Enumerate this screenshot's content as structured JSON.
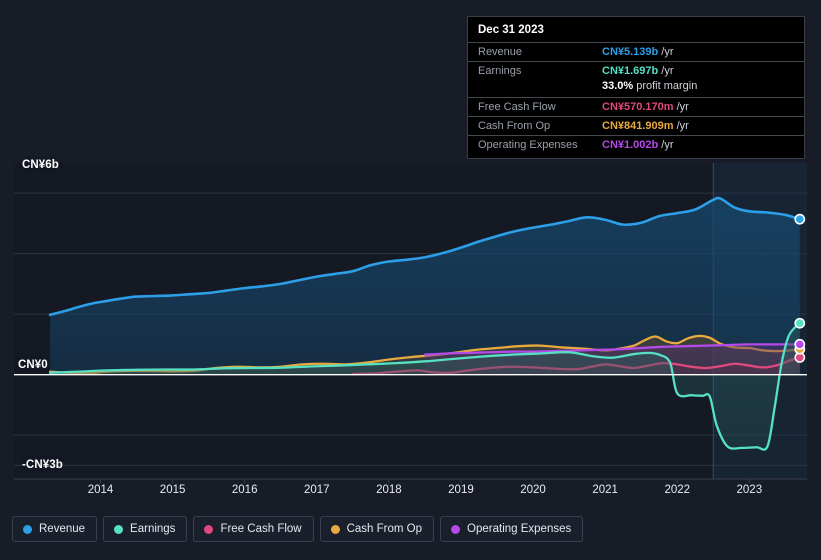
{
  "chart_data": {
    "type": "area",
    "title": "",
    "xlabel": "",
    "ylabel": "",
    "currency": "CN¥",
    "xlim": [
      2013.3,
      2024.3
    ],
    "ylim": [
      -3.45,
      6.6
    ],
    "grid": true,
    "legend_position": "bottom",
    "y_ticks": [
      {
        "value": 6,
        "label": "CN¥6b"
      },
      {
        "value": 0,
        "label": "CN¥0"
      },
      {
        "value": -3,
        "label": "-CN¥3b"
      }
    ],
    "y_gridlines": [
      6,
      4,
      2,
      0,
      -2,
      -3
    ],
    "x_ticks": [
      "2014",
      "2015",
      "2016",
      "2017",
      "2018",
      "2019",
      "2020",
      "2021",
      "2022",
      "2023"
    ],
    "forecast_divider_year": 2023.0,
    "series": [
      {
        "name": "Revenue",
        "color": "#2d9fe8",
        "fill": "#17496e",
        "start_year": 2013.8,
        "points": [
          [
            2013.8,
            1.98
          ],
          [
            2014.0,
            2.1
          ],
          [
            2014.2,
            2.24
          ],
          [
            2014.4,
            2.36
          ],
          [
            2014.6,
            2.44
          ],
          [
            2014.8,
            2.52
          ],
          [
            2015.0,
            2.58
          ],
          [
            2015.25,
            2.6
          ],
          [
            2015.5,
            2.62
          ],
          [
            2015.75,
            2.66
          ],
          [
            2016.0,
            2.7
          ],
          [
            2016.25,
            2.78
          ],
          [
            2016.5,
            2.86
          ],
          [
            2016.75,
            2.92
          ],
          [
            2017.0,
            3.0
          ],
          [
            2017.25,
            3.12
          ],
          [
            2017.5,
            3.24
          ],
          [
            2017.75,
            3.33
          ],
          [
            2018.0,
            3.42
          ],
          [
            2018.25,
            3.62
          ],
          [
            2018.5,
            3.74
          ],
          [
            2018.75,
            3.8
          ],
          [
            2019.0,
            3.88
          ],
          [
            2019.25,
            4.02
          ],
          [
            2019.5,
            4.2
          ],
          [
            2019.75,
            4.4
          ],
          [
            2020.0,
            4.58
          ],
          [
            2020.25,
            4.74
          ],
          [
            2020.5,
            4.86
          ],
          [
            2020.75,
            4.96
          ],
          [
            2021.0,
            5.08
          ],
          [
            2021.25,
            5.2
          ],
          [
            2021.5,
            5.12
          ],
          [
            2021.75,
            4.96
          ],
          [
            2022.0,
            5.02
          ],
          [
            2022.25,
            5.24
          ],
          [
            2022.5,
            5.34
          ],
          [
            2022.75,
            5.46
          ],
          [
            2023.0,
            5.78
          ],
          [
            2023.1,
            5.82
          ],
          [
            2023.3,
            5.52
          ],
          [
            2023.5,
            5.4
          ],
          [
            2023.75,
            5.36
          ],
          [
            2024.0,
            5.28
          ],
          [
            2024.2,
            5.14
          ]
        ],
        "end_value": 5.139,
        "end_label": "CN¥5.139b"
      },
      {
        "name": "Earnings",
        "color": "#56e0c4",
        "fill": "#2a5f60",
        "start_year": 2013.8,
        "points": [
          [
            2013.8,
            0.06
          ],
          [
            2014.2,
            0.1
          ],
          [
            2014.6,
            0.14
          ],
          [
            2015.0,
            0.16
          ],
          [
            2015.4,
            0.17
          ],
          [
            2015.8,
            0.17
          ],
          [
            2016.2,
            0.21
          ],
          [
            2016.6,
            0.22
          ],
          [
            2017.0,
            0.23
          ],
          [
            2017.4,
            0.27
          ],
          [
            2017.8,
            0.3
          ],
          [
            2018.2,
            0.34
          ],
          [
            2018.6,
            0.38
          ],
          [
            2019.0,
            0.44
          ],
          [
            2019.4,
            0.52
          ],
          [
            2019.8,
            0.6
          ],
          [
            2020.2,
            0.66
          ],
          [
            2020.6,
            0.7
          ],
          [
            2021.0,
            0.74
          ],
          [
            2021.3,
            0.62
          ],
          [
            2021.6,
            0.56
          ],
          [
            2021.9,
            0.68
          ],
          [
            2022.1,
            0.72
          ],
          [
            2022.25,
            0.66
          ],
          [
            2022.4,
            0.4
          ],
          [
            2022.5,
            -0.62
          ],
          [
            2022.7,
            -0.68
          ],
          [
            2022.85,
            -0.7
          ],
          [
            2022.95,
            -0.72
          ],
          [
            2023.05,
            -1.7
          ],
          [
            2023.2,
            -2.38
          ],
          [
            2023.4,
            -2.42
          ],
          [
            2023.6,
            -2.4
          ],
          [
            2023.75,
            -2.38
          ],
          [
            2023.85,
            -1.1
          ],
          [
            2023.95,
            0.4
          ],
          [
            2024.05,
            1.3
          ],
          [
            2024.2,
            1.7
          ]
        ],
        "end_value": 1.697,
        "end_label": "CN¥1.697b",
        "profit_margin": "33.0%"
      },
      {
        "name": "Free Cash Flow",
        "color": "#e0487e",
        "fill": "#6d2b4a",
        "start_year": 2018.0,
        "points": [
          [
            2018.0,
            0.02
          ],
          [
            2018.3,
            0.04
          ],
          [
            2018.6,
            0.1
          ],
          [
            2018.9,
            0.14
          ],
          [
            2019.1,
            0.08
          ],
          [
            2019.35,
            0.06
          ],
          [
            2019.6,
            0.14
          ],
          [
            2019.9,
            0.22
          ],
          [
            2020.2,
            0.26
          ],
          [
            2020.5,
            0.24
          ],
          [
            2020.8,
            0.2
          ],
          [
            2021.1,
            0.18
          ],
          [
            2021.3,
            0.26
          ],
          [
            2021.5,
            0.34
          ],
          [
            2021.7,
            0.28
          ],
          [
            2021.9,
            0.22
          ],
          [
            2022.1,
            0.3
          ],
          [
            2022.3,
            0.38
          ],
          [
            2022.5,
            0.34
          ],
          [
            2022.7,
            0.26
          ],
          [
            2022.9,
            0.22
          ],
          [
            2023.1,
            0.28
          ],
          [
            2023.3,
            0.36
          ],
          [
            2023.5,
            0.3
          ],
          [
            2023.7,
            0.24
          ],
          [
            2023.9,
            0.32
          ],
          [
            2024.05,
            0.46
          ],
          [
            2024.2,
            0.57
          ]
        ],
        "end_value": 0.57017,
        "end_label": "CN¥570.170m"
      },
      {
        "name": "Cash From Op",
        "color": "#e8a93f",
        "fill": "#6a5228",
        "start_year": 2013.8,
        "points": [
          [
            2013.8,
            0.1
          ],
          [
            2014.05,
            0.06
          ],
          [
            2014.3,
            0.04
          ],
          [
            2014.6,
            0.1
          ],
          [
            2014.9,
            0.12
          ],
          [
            2015.2,
            0.12
          ],
          [
            2015.5,
            0.11
          ],
          [
            2015.8,
            0.13
          ],
          [
            2016.1,
            0.22
          ],
          [
            2016.4,
            0.26
          ],
          [
            2016.7,
            0.24
          ],
          [
            2017.0,
            0.26
          ],
          [
            2017.3,
            0.34
          ],
          [
            2017.6,
            0.36
          ],
          [
            2017.9,
            0.34
          ],
          [
            2018.2,
            0.4
          ],
          [
            2018.5,
            0.5
          ],
          [
            2018.8,
            0.58
          ],
          [
            2019.1,
            0.64
          ],
          [
            2019.4,
            0.72
          ],
          [
            2019.7,
            0.82
          ],
          [
            2020.0,
            0.88
          ],
          [
            2020.3,
            0.94
          ],
          [
            2020.6,
            0.96
          ],
          [
            2020.9,
            0.9
          ],
          [
            2021.2,
            0.86
          ],
          [
            2021.5,
            0.8
          ],
          [
            2021.7,
            0.86
          ],
          [
            2021.9,
            0.96
          ],
          [
            2022.05,
            1.14
          ],
          [
            2022.2,
            1.26
          ],
          [
            2022.35,
            1.1
          ],
          [
            2022.5,
            1.04
          ],
          [
            2022.65,
            1.2
          ],
          [
            2022.8,
            1.28
          ],
          [
            2022.95,
            1.22
          ],
          [
            2023.1,
            1.02
          ],
          [
            2023.3,
            0.9
          ],
          [
            2023.5,
            0.88
          ],
          [
            2023.7,
            0.8
          ],
          [
            2023.9,
            0.78
          ],
          [
            2024.05,
            0.8
          ],
          [
            2024.2,
            0.84
          ]
        ],
        "end_value": 0.841909,
        "end_label": "CN¥841.909m"
      },
      {
        "name": "Operating Expenses",
        "color": "#b44ae8",
        "fill": "#5a2f73",
        "start_year": 2019.0,
        "points": [
          [
            2019.0,
            0.66
          ],
          [
            2019.3,
            0.7
          ],
          [
            2019.6,
            0.72
          ],
          [
            2019.9,
            0.74
          ],
          [
            2020.2,
            0.76
          ],
          [
            2020.5,
            0.76
          ],
          [
            2020.8,
            0.78
          ],
          [
            2021.1,
            0.8
          ],
          [
            2021.4,
            0.82
          ],
          [
            2021.7,
            0.84
          ],
          [
            2022.0,
            0.88
          ],
          [
            2022.3,
            0.92
          ],
          [
            2022.6,
            0.94
          ],
          [
            2022.9,
            0.96
          ],
          [
            2023.2,
            0.98
          ],
          [
            2023.5,
            1.0
          ],
          [
            2023.8,
            1.0
          ],
          [
            2024.05,
            1.0
          ],
          [
            2024.2,
            1.002
          ]
        ],
        "end_value": 1.002,
        "end_label": "CN¥1.002b"
      }
    ]
  },
  "tooltip": {
    "date": "Dec 31 2023",
    "unit_suffix": "/yr",
    "rows": [
      {
        "label": "Revenue",
        "value": "CN¥5.139b",
        "unit": "/yr",
        "color": "#2d9fe8"
      },
      {
        "label": "Earnings",
        "value": "CN¥1.697b",
        "unit": "/yr",
        "color": "#56e0c4"
      },
      {
        "label": "",
        "value": "33.0%",
        "unit": "profit margin",
        "color": "#ffffff",
        "sub": true
      },
      {
        "label": "Free Cash Flow",
        "value": "CN¥570.170m",
        "unit": "/yr",
        "color": "#e0487e"
      },
      {
        "label": "Cash From Op",
        "value": "CN¥841.909m",
        "unit": "/yr",
        "color": "#e8a93f"
      },
      {
        "label": "Operating Expenses",
        "value": "CN¥1.002b",
        "unit": "/yr",
        "color": "#b44ae8"
      }
    ]
  },
  "legend": {
    "items": [
      {
        "label": "Revenue",
        "color": "#2d9fe8"
      },
      {
        "label": "Earnings",
        "color": "#56e0c4"
      },
      {
        "label": "Free Cash Flow",
        "color": "#e0487e"
      },
      {
        "label": "Cash From Op",
        "color": "#e8a93f"
      },
      {
        "label": "Operating Expenses",
        "color": "#b44ae8"
      }
    ]
  },
  "colors": {
    "background": "#171c26",
    "plot_background": "#141924",
    "zero_line": "#ffffff",
    "gridline": "#2c3340",
    "forecast_divider": "#3f5a74"
  }
}
